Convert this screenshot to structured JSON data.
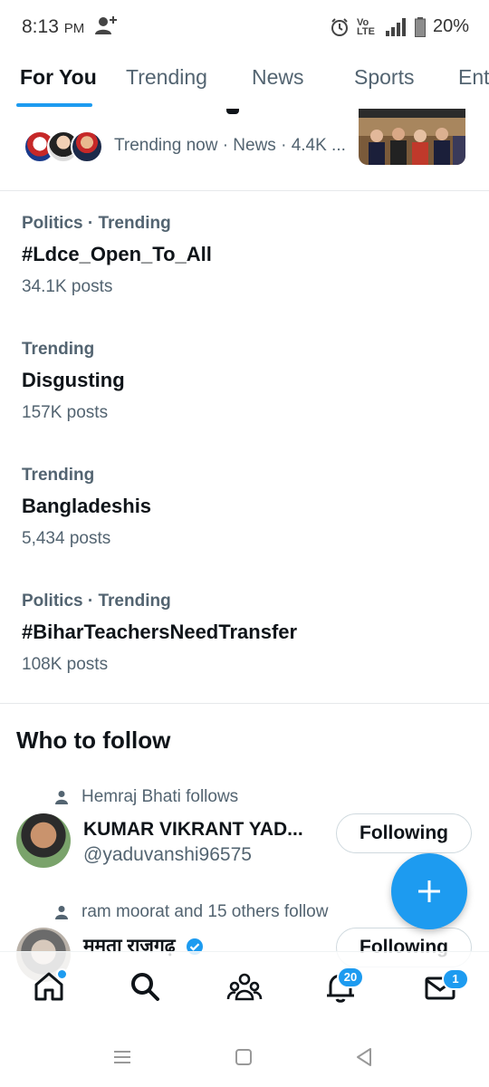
{
  "status": {
    "time": "8:13",
    "ampm": "PM",
    "network": "Vo LTE",
    "battery": "20%"
  },
  "tabs": [
    "For You",
    "Trending",
    "News",
    "Sports",
    "Ent"
  ],
  "news": {
    "meta": "Trending now · News · 4.4K ..."
  },
  "trends": [
    {
      "context": "Politics · Trending",
      "title": "#Ldce_Open_To_All",
      "count": "34.1K posts"
    },
    {
      "context": "Trending",
      "title": "Disgusting",
      "count": "157K posts"
    },
    {
      "context": "Trending",
      "title": "Bangladeshis",
      "count": "5,434 posts"
    },
    {
      "context": "Politics · Trending",
      "title": "#BiharTeachersNeedTransfer",
      "count": "108K posts"
    }
  ],
  "who_to_follow": {
    "heading": "Who to follow",
    "users": [
      {
        "social": "Hemraj Bhati follows",
        "name": "KUMAR VIKRANT YAD...",
        "handle": "@yaduvanshi96575",
        "button": "Following"
      },
      {
        "social": "ram moorat and 15 others follow",
        "name": "ममता राजगढ़",
        "handle": "",
        "button": "Following"
      }
    ]
  },
  "nav": {
    "notifications_badge": "20",
    "messages_badge": "1"
  },
  "colors": {
    "accent": "#1d9bf0",
    "text": "#0f1419",
    "muted": "#536471"
  }
}
